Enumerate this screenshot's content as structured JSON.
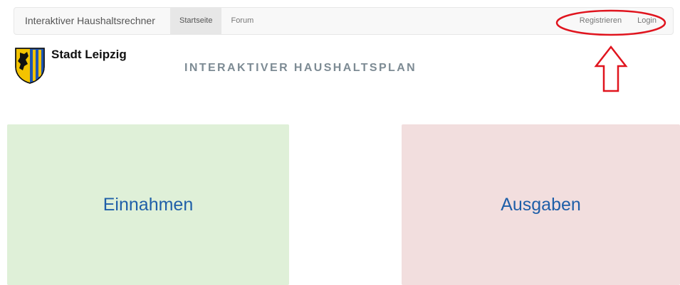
{
  "navbar": {
    "brand": "Interaktiver Haushaltsrechner",
    "links_left": [
      {
        "label": "Startseite",
        "active": true
      },
      {
        "label": "Forum",
        "active": false
      }
    ],
    "links_right": [
      {
        "label": "Registrieren"
      },
      {
        "label": "Login"
      }
    ]
  },
  "header": {
    "city_name": "Stadt Leipzig",
    "plan_title": "INTERAKTIVER HAUSHALTSPLAN"
  },
  "tiles": {
    "income_label": "Einnahmen",
    "expense_label": "Ausgaben"
  },
  "colors": {
    "income_bg": "#dff0d8",
    "expense_bg": "#f2dede",
    "tile_text": "#1f5fa8",
    "annotation": "#e0141e"
  },
  "icons": {
    "crest": "leipzig-coat-of-arms-icon",
    "annotation_arrow": "up-arrow-icon"
  }
}
